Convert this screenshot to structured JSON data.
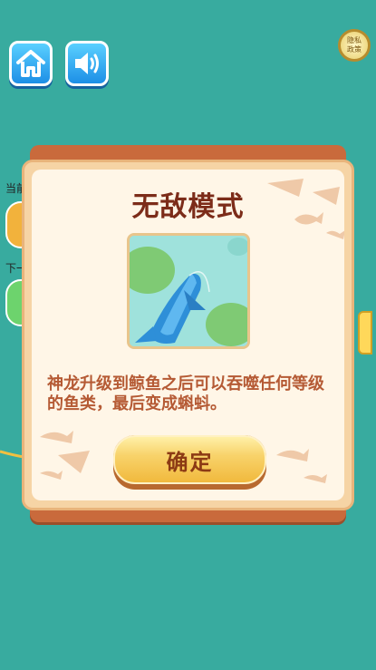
{
  "top_bar": {
    "home_icon": "home-icon",
    "sound_icon": "speaker-icon",
    "privacy_line1": "隐私",
    "privacy_line2": "政策"
  },
  "background": {
    "label_current": "当前",
    "label_next": "下一"
  },
  "dialog": {
    "title": "无敌模式",
    "description": "神龙升级到鲸鱼之后可以吞噬任何等级的鱼类，最后变成蝌蚪。",
    "confirm_label": "确定"
  },
  "colors": {
    "background": "#38ab9f",
    "title": "#7c2c19",
    "description": "#b55a34",
    "button": "#f8d36b"
  }
}
